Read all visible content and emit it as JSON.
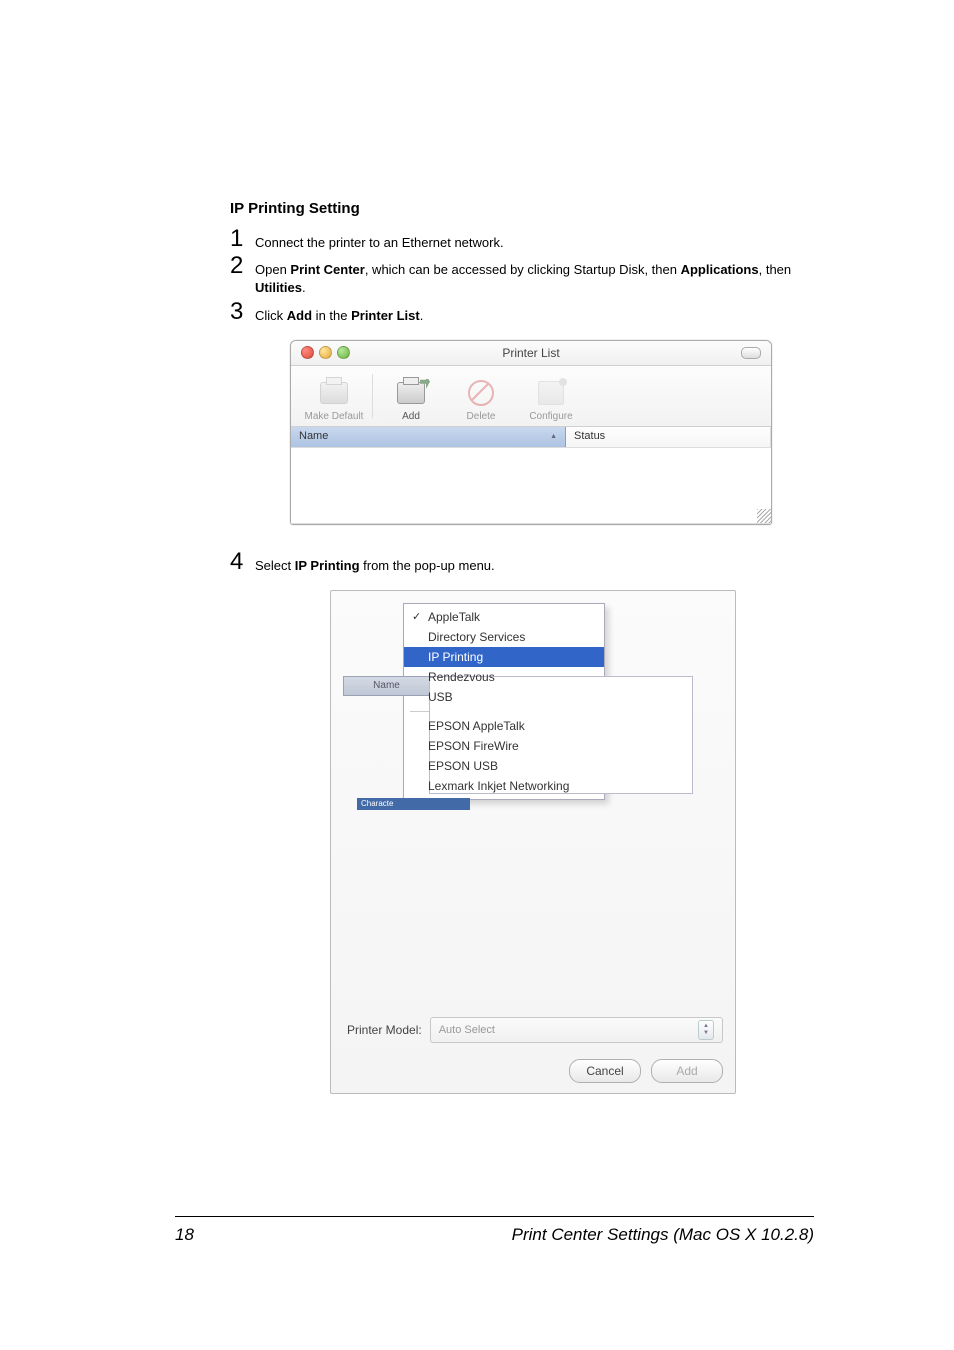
{
  "heading": "IP Printing Setting",
  "steps": {
    "s1": {
      "num": "1",
      "text_a": "Connect the printer to an Ethernet network."
    },
    "s2": {
      "num": "2",
      "text_a": "Open ",
      "bold_a": "Print Center",
      "text_b": ", which can be accessed by clicking Startup Disk, then ",
      "bold_b": "Applications",
      "text_c": ", then ",
      "bold_c": "Utilities",
      "text_d": "."
    },
    "s3": {
      "num": "3",
      "text_a": "Click ",
      "bold_a": "Add",
      "text_b": " in the ",
      "bold_b": "Printer List",
      "text_c": "."
    },
    "s4": {
      "num": "4",
      "text_a": "Select ",
      "bold_a": "IP Printing",
      "text_b": " from the pop-up menu."
    }
  },
  "window1": {
    "title": "Printer List",
    "toolbar": {
      "make_default": "Make Default",
      "add": "Add",
      "delete": "Delete",
      "configure": "Configure"
    },
    "columns": {
      "name": "Name",
      "status": "Status"
    }
  },
  "sheet": {
    "name_label": "Name",
    "menu": {
      "appletalk": "AppleTalk",
      "directory": "Directory Services",
      "ipprinting": "IP Printing",
      "rendezvous": "Rendezvous",
      "usb": "USB",
      "epson_at": "EPSON AppleTalk",
      "epson_fw": "EPSON FireWire",
      "epson_usb": "EPSON USB",
      "lexmark": "Lexmark Inkjet Networking"
    },
    "charset": "Characte",
    "model_label": "Printer Model:",
    "model_value": "Auto Select",
    "cancel": "Cancel",
    "add": "Add"
  },
  "footer": {
    "page": "18",
    "title": "Print Center Settings (Mac OS X 10.2.8)"
  }
}
